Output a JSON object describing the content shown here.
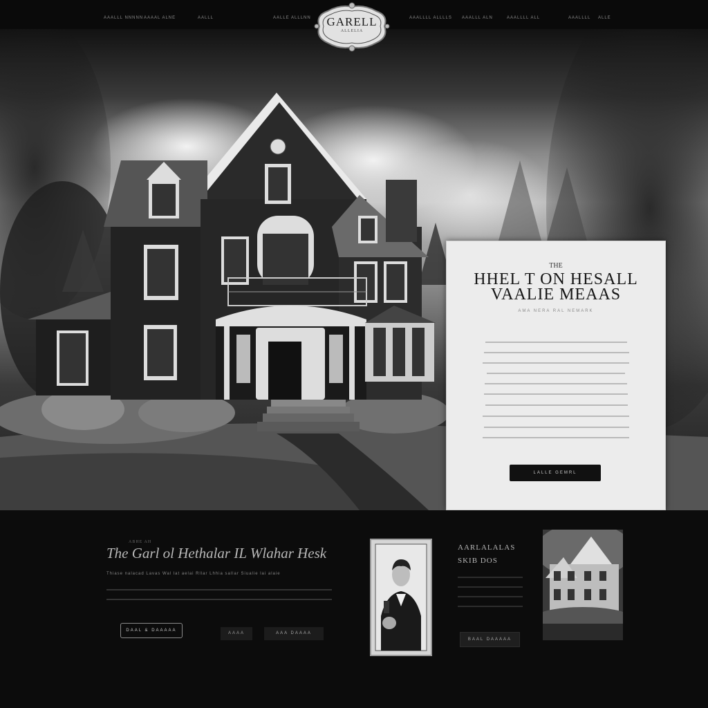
{
  "nav": {
    "left_items": [
      "AAALLL NNNNN",
      "AAAAL ALNE",
      "AALLL",
      "AALLE ALLLNN"
    ],
    "right_items": [
      "AAALLLL ALLLLS",
      "AAALLL ALN",
      "AAALLLL ALL",
      "AAALLLL",
      "ALLE"
    ]
  },
  "logo": {
    "text": "GARELL",
    "subtext": "ALLELIA"
  },
  "hero_card": {
    "kicker": "THE",
    "title_line1": "HHEL T ON HESALL",
    "title_line2": "VAALIE MEAAS",
    "subtitle": "AMA NERA RAL NEMARK",
    "button_label": "LALLE GEMRL"
  },
  "feature": {
    "kicker": "ABHE AH",
    "title": "The Garl ol Hethalar IL Wlahar Hesk",
    "subtitle": "Thiase nalacad Lavas Wal lat aelai Rllar Lhhia sallar Siualie lai alaie",
    "buttons": [
      "DAAL & DAAAAA",
      "AAAA",
      "AAA DAAAA"
    ]
  },
  "aside": {
    "title": "AARLALALAS",
    "subtitle": "SKIB DOS",
    "button_label": "BAAL DAAAAA"
  },
  "colors": {
    "background": "#0b0b0b",
    "card": "#ececec",
    "cta": "#111111"
  },
  "icons": [
    "crest-logo",
    "house-illustration",
    "portrait-photo",
    "house-thumbnail"
  ]
}
